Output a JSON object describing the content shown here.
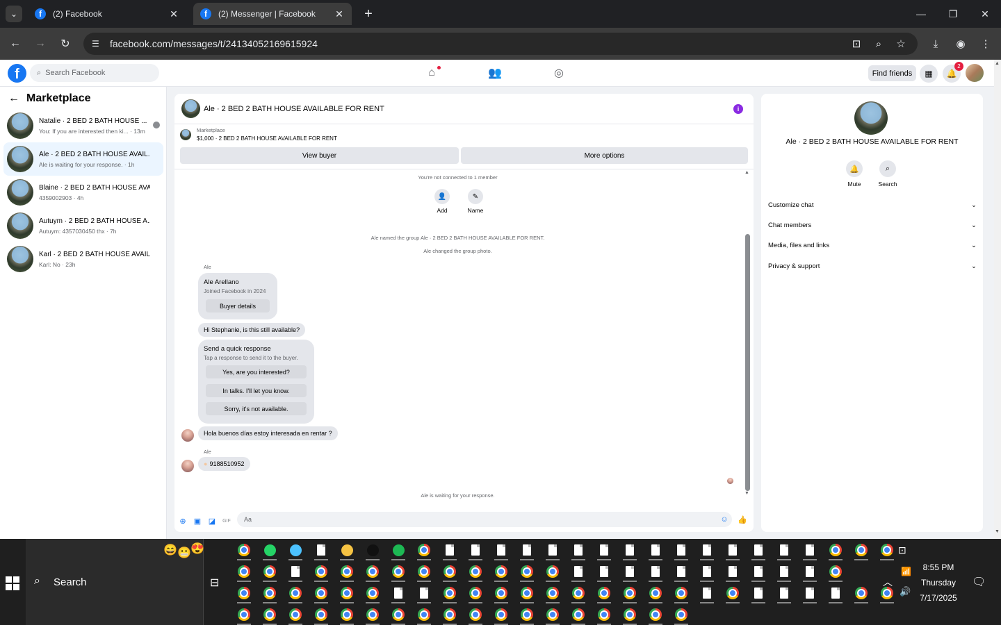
{
  "browser": {
    "tabs": [
      {
        "title": "(2) Facebook",
        "active": false
      },
      {
        "title": "(2) Messenger | Facebook",
        "active": true
      }
    ],
    "url": "facebook.com/messages/t/24134052169615924"
  },
  "fb_header": {
    "search_placeholder": "Search Facebook",
    "find_friends": "Find friends",
    "notification_count": "2"
  },
  "left": {
    "title": "Marketplace",
    "conversations": [
      {
        "name": "Natalie · 2 BED 2 BATH HOUSE ...",
        "preview": "You: If you are interested then ki... · 13m",
        "selected": false
      },
      {
        "name": "Ale · 2 BED 2 BATH HOUSE AVAIL...",
        "preview": "Ale is waiting for your response. · 1h",
        "selected": true
      },
      {
        "name": "Blaine · 2 BED 2 BATH HOUSE AVA...",
        "preview": "4359002903 · 4h",
        "selected": false
      },
      {
        "name": "Autuym · 2 BED 2 BATH HOUSE A...",
        "preview": "Autuym: 4357030450 thx · 7h",
        "selected": false
      },
      {
        "name": "Karl · 2 BED 2 BATH HOUSE AVAIL...",
        "preview": "Karl: No · 23h",
        "selected": false
      }
    ]
  },
  "chat": {
    "header_name": "Ale · 2 BED 2 BATH HOUSE AVAILABLE FOR RENT",
    "marketplace_label": "Marketplace",
    "listing": "$1,000 · 2 BED 2 BATH HOUSE AVAILABLE FOR RENT",
    "view_buyer": "View buyer",
    "more_options": "More options",
    "not_connected": "You're not connected to 1 member",
    "add_label": "Add",
    "name_label": "Name",
    "sys_named": "Ale named the group Ale · 2 BED 2 BATH HOUSE AVAILABLE FOR RENT.",
    "sys_photo": "Ale changed the group photo.",
    "sender1": "Ale",
    "buyer_name": "Ale Arellano",
    "buyer_joined": "Joined Facebook in 2024",
    "buyer_details": "Buyer details",
    "msg_available": "Hi Stephanie, is this still available?",
    "quick_title": "Send a quick response",
    "quick_sub": "Tap a response to send it to the buyer.",
    "quick_1": "Yes, are you interested?",
    "quick_2": "In talks. I'll let you know.",
    "quick_3": "Sorry, it's not available.",
    "msg_hola": "Hola buenos días estoy interesada en rentar ?",
    "sender2": "Ale",
    "msg_phone": "9188510952",
    "waiting": "Ale is waiting for your response.",
    "composer_placeholder": "Aa"
  },
  "right": {
    "name": "Ale · 2 BED 2 BATH HOUSE AVAILABLE FOR RENT",
    "mute": "Mute",
    "search": "Search",
    "sections": [
      "Customize chat",
      "Chat members",
      "Media, files and links",
      "Privacy & support"
    ]
  },
  "taskbar": {
    "search_label": "Search",
    "time": "8:55 PM",
    "day": "Thursday",
    "date": "7/17/2025"
  },
  "colors": {
    "fb_blue": "#1877f2",
    "info_purple": "#8a2be2",
    "badge_red": "#e41e3f"
  }
}
